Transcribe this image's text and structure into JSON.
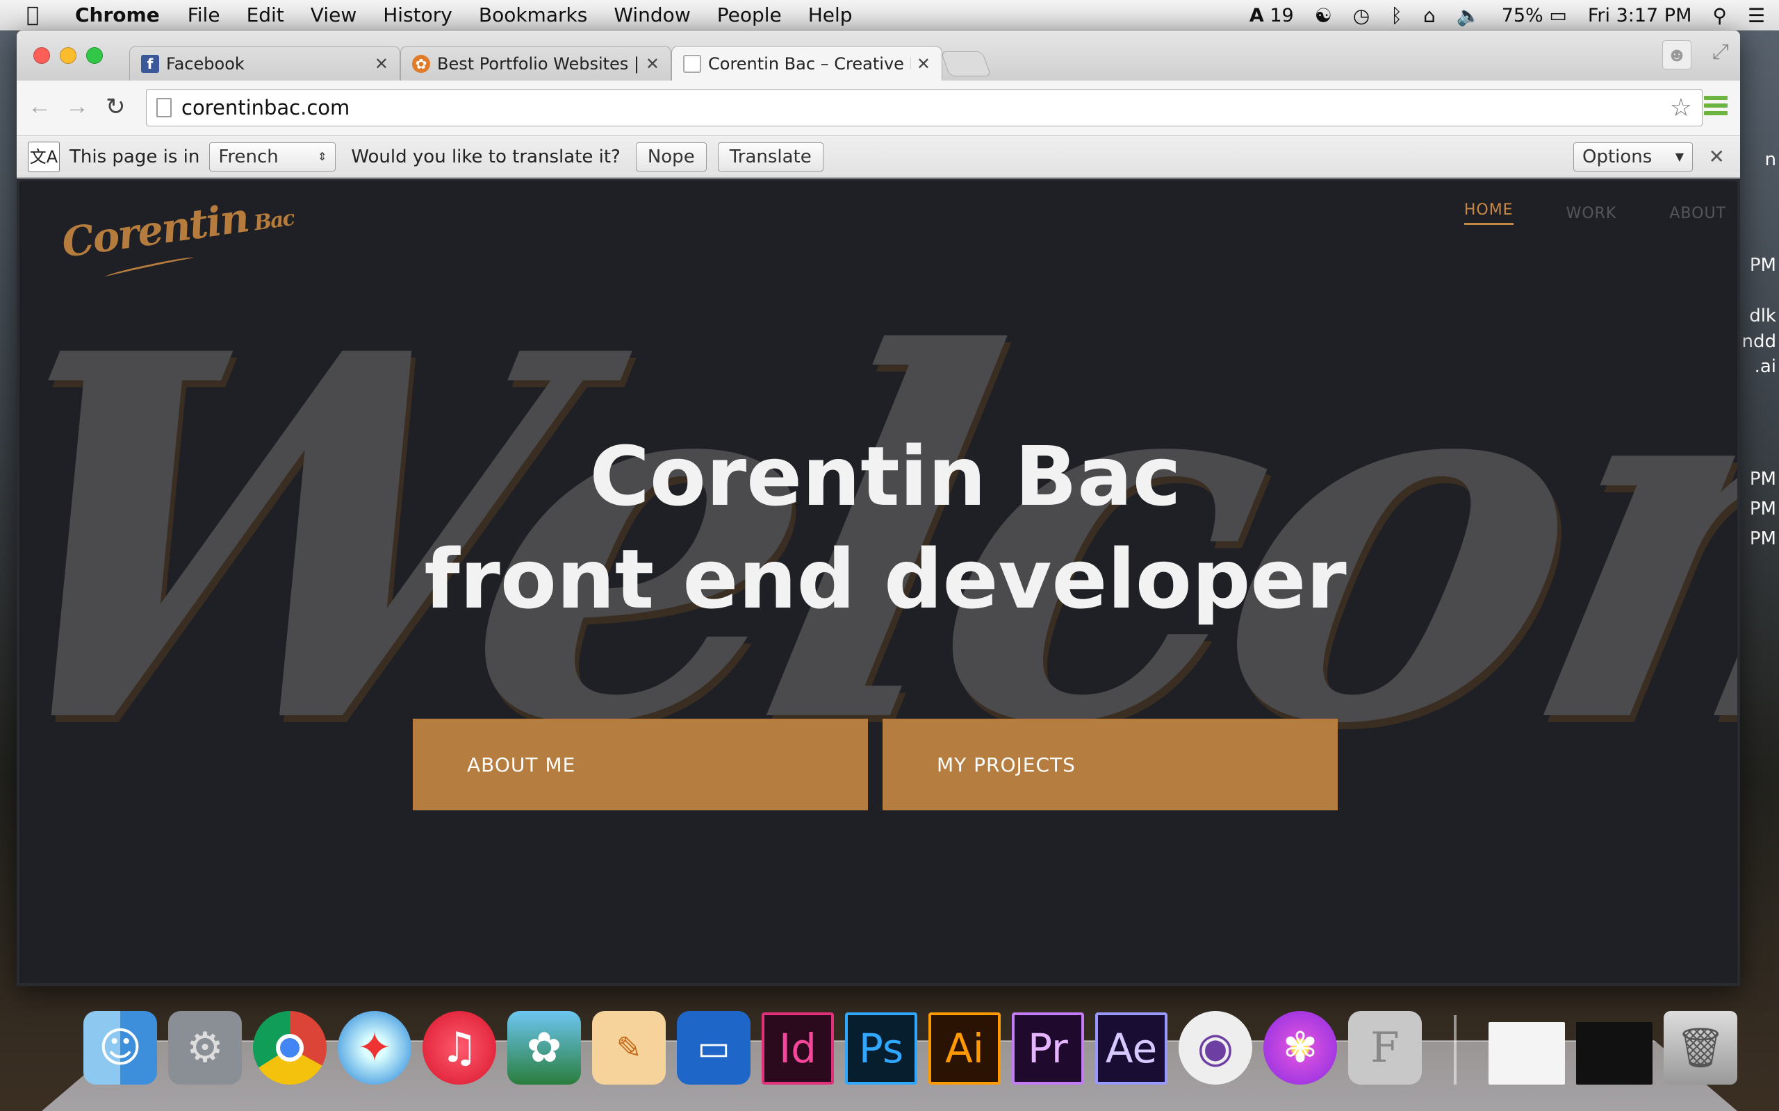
{
  "menubar": {
    "app": "Chrome",
    "items": [
      "File",
      "Edit",
      "View",
      "History",
      "Bookmarks",
      "Window",
      "People",
      "Help"
    ],
    "adobe_count": "19",
    "battery": "75%",
    "clock": "Fri 3:17 PM"
  },
  "desktop_edge": {
    "t1": "n",
    "t2": "PM",
    "t3": "dlk",
    "t4": "ndd",
    "t5": ".ai",
    "t6": "PM",
    "t7": "PM",
    "t8": "PM"
  },
  "tabs": [
    {
      "title": "Facebook",
      "icon": "facebook-icon",
      "color": "#3b5998"
    },
    {
      "title": "Best Portfolio Websites | W",
      "icon": "site-icon",
      "color": "#e07b2a"
    },
    {
      "title": "Corentin Bac – Creative De",
      "icon": "page-icon",
      "color": "#ffffff"
    }
  ],
  "omnibox": {
    "url": "corentinbac.com"
  },
  "translate_bar": {
    "prefix": "This page is in",
    "language": "French",
    "question": "Would you like to translate it?",
    "nope": "Nope",
    "translate": "Translate",
    "options": "Options"
  },
  "site": {
    "logo_main": "Corentin",
    "logo_small": "Bac",
    "nav": [
      "HOME",
      "WORK",
      "ABOUT"
    ],
    "bg_word": "Welcome",
    "headline_1": "Corentin Bac",
    "headline_2": "front end developer",
    "cta_about": "ABOUT ME",
    "cta_projects": "MY PROJECTS",
    "accent": "#b67d40",
    "background": "#1f2025"
  },
  "dock": {
    "apps": [
      "finder-icon",
      "system-preferences-icon",
      "chrome-icon",
      "safari-icon",
      "itunes-icon",
      "iphoto-icon",
      "pages-icon",
      "keynote-icon",
      "indesign-icon",
      "photoshop-icon",
      "illustrator-icon",
      "premiere-icon",
      "after-effects-icon",
      "github-icon",
      "flower-app-icon",
      "fontlab-icon"
    ],
    "adobe_labels": {
      "id": "Id",
      "ps": "Ps",
      "ai": "Ai",
      "pr": "Pr",
      "ae": "Ae"
    }
  }
}
